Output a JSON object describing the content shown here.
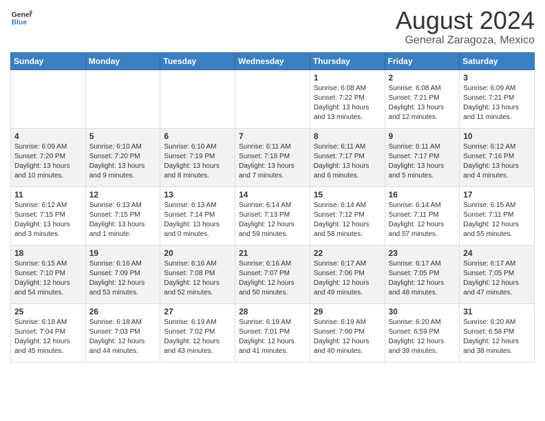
{
  "logo": {
    "line1": "General",
    "line2": "Blue"
  },
  "title": "August 2024",
  "subtitle": "General Zaragoza, Mexico",
  "days_of_week": [
    "Sunday",
    "Monday",
    "Tuesday",
    "Wednesday",
    "Thursday",
    "Friday",
    "Saturday"
  ],
  "weeks": [
    [
      {
        "day": "",
        "text": ""
      },
      {
        "day": "",
        "text": ""
      },
      {
        "day": "",
        "text": ""
      },
      {
        "day": "",
        "text": ""
      },
      {
        "day": "1",
        "text": "Sunrise: 6:08 AM\nSunset: 7:22 PM\nDaylight: 13 hours\nand 13 minutes."
      },
      {
        "day": "2",
        "text": "Sunrise: 6:08 AM\nSunset: 7:21 PM\nDaylight: 13 hours\nand 12 minutes."
      },
      {
        "day": "3",
        "text": "Sunrise: 6:09 AM\nSunset: 7:21 PM\nDaylight: 13 hours\nand 11 minutes."
      }
    ],
    [
      {
        "day": "4",
        "text": "Sunrise: 6:09 AM\nSunset: 7:20 PM\nDaylight: 13 hours\nand 10 minutes."
      },
      {
        "day": "5",
        "text": "Sunrise: 6:10 AM\nSunset: 7:20 PM\nDaylight: 13 hours\nand 9 minutes."
      },
      {
        "day": "6",
        "text": "Sunrise: 6:10 AM\nSunset: 7:19 PM\nDaylight: 13 hours\nand 8 minutes."
      },
      {
        "day": "7",
        "text": "Sunrise: 6:11 AM\nSunset: 7:18 PM\nDaylight: 13 hours\nand 7 minutes."
      },
      {
        "day": "8",
        "text": "Sunrise: 6:11 AM\nSunset: 7:17 PM\nDaylight: 13 hours\nand 6 minutes."
      },
      {
        "day": "9",
        "text": "Sunrise: 6:11 AM\nSunset: 7:17 PM\nDaylight: 13 hours\nand 5 minutes."
      },
      {
        "day": "10",
        "text": "Sunrise: 6:12 AM\nSunset: 7:16 PM\nDaylight: 13 hours\nand 4 minutes."
      }
    ],
    [
      {
        "day": "11",
        "text": "Sunrise: 6:12 AM\nSunset: 7:15 PM\nDaylight: 13 hours\nand 3 minutes."
      },
      {
        "day": "12",
        "text": "Sunrise: 6:13 AM\nSunset: 7:15 PM\nDaylight: 13 hours\nand 1 minute."
      },
      {
        "day": "13",
        "text": "Sunrise: 6:13 AM\nSunset: 7:14 PM\nDaylight: 13 hours\nand 0 minutes."
      },
      {
        "day": "14",
        "text": "Sunrise: 6:14 AM\nSunset: 7:13 PM\nDaylight: 12 hours\nand 59 minutes."
      },
      {
        "day": "15",
        "text": "Sunrise: 6:14 AM\nSunset: 7:12 PM\nDaylight: 12 hours\nand 58 minutes."
      },
      {
        "day": "16",
        "text": "Sunrise: 6:14 AM\nSunset: 7:11 PM\nDaylight: 12 hours\nand 57 minutes."
      },
      {
        "day": "17",
        "text": "Sunrise: 6:15 AM\nSunset: 7:11 PM\nDaylight: 12 hours\nand 55 minutes."
      }
    ],
    [
      {
        "day": "18",
        "text": "Sunrise: 6:15 AM\nSunset: 7:10 PM\nDaylight: 12 hours\nand 54 minutes."
      },
      {
        "day": "19",
        "text": "Sunrise: 6:16 AM\nSunset: 7:09 PM\nDaylight: 12 hours\nand 53 minutes."
      },
      {
        "day": "20",
        "text": "Sunrise: 6:16 AM\nSunset: 7:08 PM\nDaylight: 12 hours\nand 52 minutes."
      },
      {
        "day": "21",
        "text": "Sunrise: 6:16 AM\nSunset: 7:07 PM\nDaylight: 12 hours\nand 50 minutes."
      },
      {
        "day": "22",
        "text": "Sunrise: 6:17 AM\nSunset: 7:06 PM\nDaylight: 12 hours\nand 49 minutes."
      },
      {
        "day": "23",
        "text": "Sunrise: 6:17 AM\nSunset: 7:05 PM\nDaylight: 12 hours\nand 48 minutes."
      },
      {
        "day": "24",
        "text": "Sunrise: 6:17 AM\nSunset: 7:05 PM\nDaylight: 12 hours\nand 47 minutes."
      }
    ],
    [
      {
        "day": "25",
        "text": "Sunrise: 6:18 AM\nSunset: 7:04 PM\nDaylight: 12 hours\nand 45 minutes."
      },
      {
        "day": "26",
        "text": "Sunrise: 6:18 AM\nSunset: 7:03 PM\nDaylight: 12 hours\nand 44 minutes."
      },
      {
        "day": "27",
        "text": "Sunrise: 6:19 AM\nSunset: 7:02 PM\nDaylight: 12 hours\nand 43 minutes."
      },
      {
        "day": "28",
        "text": "Sunrise: 6:19 AM\nSunset: 7:01 PM\nDaylight: 12 hours\nand 41 minutes."
      },
      {
        "day": "29",
        "text": "Sunrise: 6:19 AM\nSunset: 7:00 PM\nDaylight: 12 hours\nand 40 minutes."
      },
      {
        "day": "30",
        "text": "Sunrise: 6:20 AM\nSunset: 6:59 PM\nDaylight: 12 hours\nand 39 minutes."
      },
      {
        "day": "31",
        "text": "Sunrise: 6:20 AM\nSunset: 6:58 PM\nDaylight: 12 hours\nand 38 minutes."
      }
    ]
  ]
}
